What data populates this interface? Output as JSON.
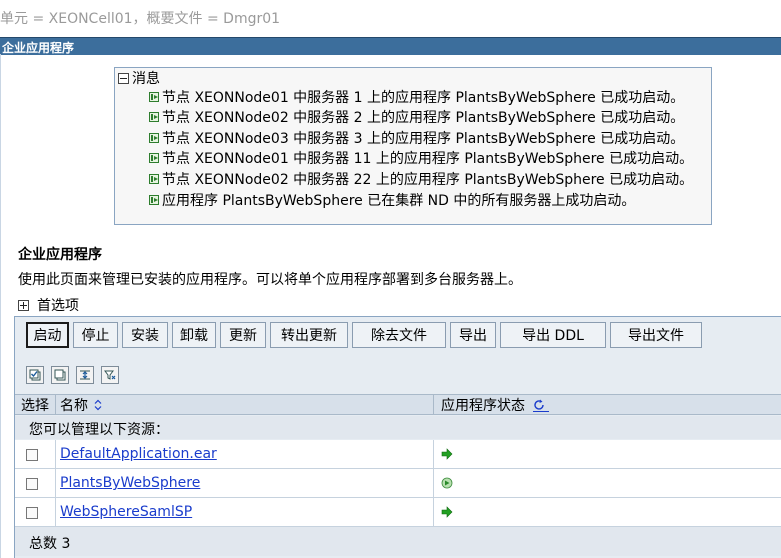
{
  "scope": {
    "text": "单元 = XEONCell01，概要文件 = Dmgr01"
  },
  "page_title": "企业应用程序",
  "messages": {
    "header": "消息",
    "items": [
      "节点 XEONNode01 中服务器 1 上的应用程序 PlantsByWebSphere 已成功启动。",
      "节点 XEONNode02 中服务器 2 上的应用程序 PlantsByWebSphere 已成功启动。",
      "节点 XEONNode03 中服务器 3 上的应用程序 PlantsByWebSphere 已成功启动。",
      "节点 XEONNode01 中服务器 11 上的应用程序 PlantsByWebSphere 已成功启动。",
      "节点 XEONNode02 中服务器 22 上的应用程序 PlantsByWebSphere 已成功启动。",
      "应用程序 PlantsByWebSphere 已在集群 ND 中的所有服务器上成功启动。"
    ]
  },
  "section": {
    "title": "企业应用程序",
    "description": "使用此页面来管理已安装的应用程序。可以将单个应用程序部署到多台服务器上。",
    "preferences": "首选项"
  },
  "toolbar": {
    "start": "启动",
    "stop": "停止",
    "install": "安装",
    "uninstall": "卸载",
    "update": "更新",
    "rollout_update": "转出更新",
    "remove_file": "除去文件",
    "export": "导出",
    "export_ddl": "导出 DDL",
    "export_file": "导出文件"
  },
  "table_icons": [
    "select-all-icon",
    "deselect-all-icon",
    "show-filter-icon",
    "clear-filter-icon"
  ],
  "table": {
    "headers": {
      "select": "选择",
      "name": "名称",
      "status": "应用程序状态"
    },
    "caption": "您可以管理以下资源：",
    "rows": [
      {
        "name": "DefaultApplication.ear",
        "status": "started"
      },
      {
        "name": "PlantsByWebSphere",
        "status": "partial-start"
      },
      {
        "name": "WebSphereSamlSP",
        "status": "started"
      }
    ],
    "total_label": "总数 3"
  },
  "colors": {
    "title_bar": "#3c6e9c",
    "panel_bg": "#e6ecf2",
    "link": "#1a3ccc",
    "status_started": "#22a022"
  }
}
